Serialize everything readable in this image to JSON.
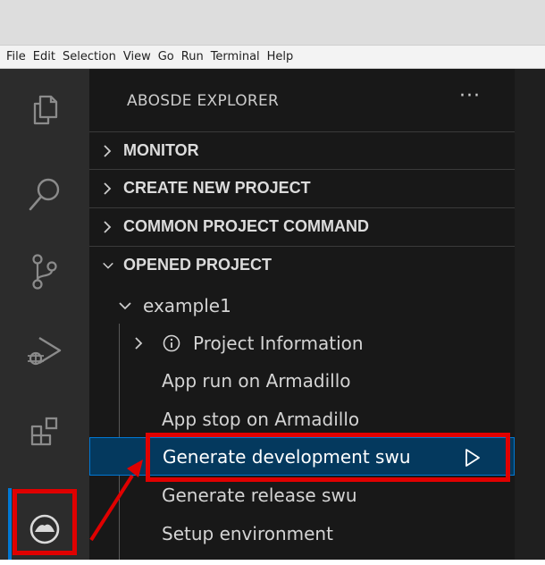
{
  "menu": [
    "File",
    "Edit",
    "Selection",
    "View",
    "Go",
    "Run",
    "Terminal",
    "Help"
  ],
  "activity_bar": {
    "items": [
      {
        "name": "explorer-icon"
      },
      {
        "name": "search-icon"
      },
      {
        "name": "source-control-icon"
      },
      {
        "name": "run-debug-icon"
      },
      {
        "name": "extensions-icon"
      },
      {
        "name": "abosde-icon"
      }
    ]
  },
  "sidebar": {
    "title": "ABOSDE EXPLORER",
    "more": "···",
    "sections": [
      {
        "label": "MONITOR",
        "expanded": false
      },
      {
        "label": "CREATE NEW PROJECT",
        "expanded": false
      },
      {
        "label": "COMMON PROJECT COMMAND",
        "expanded": false
      },
      {
        "label": "OPENED PROJECT",
        "expanded": true
      }
    ],
    "project": {
      "name": "example1",
      "items": [
        {
          "label": "Project Information"
        },
        {
          "label": "App run on Armadillo"
        },
        {
          "label": "App stop on Armadillo"
        },
        {
          "label": "Generate development swu"
        },
        {
          "label": "Generate release swu"
        },
        {
          "label": "Setup environment"
        }
      ]
    }
  },
  "colors": {
    "highlight": "#e00000",
    "selection": "#04395e",
    "accent": "#0078d4"
  }
}
